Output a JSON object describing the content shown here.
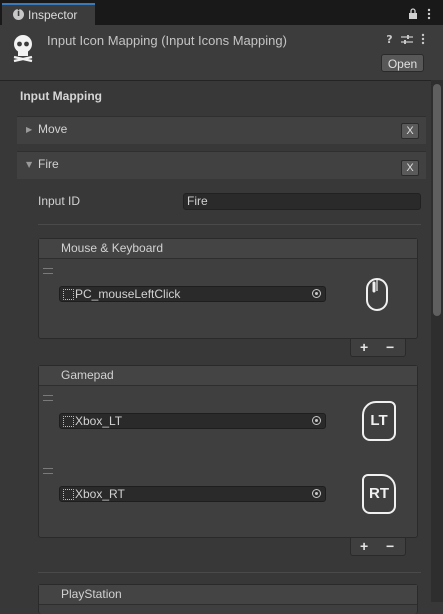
{
  "tab": {
    "label": "Inspector"
  },
  "header": {
    "title": "Input Icon Mapping (Input Icons Mapping)",
    "open_label": "Open"
  },
  "section_title": "Input Mapping",
  "entries": [
    {
      "label": "Move",
      "remove_label": "X"
    },
    {
      "label": "Fire",
      "remove_label": "X"
    }
  ],
  "fire": {
    "input_id_label": "Input ID",
    "input_id_value": "Fire",
    "groups": [
      {
        "title": "Mouse & Keyboard",
        "items": [
          {
            "value": "PC_mouseLeftClick",
            "icon": "mouse-left-click-icon"
          }
        ]
      },
      {
        "title": "Gamepad",
        "items": [
          {
            "value": "Xbox_LT",
            "icon_text": "LT"
          },
          {
            "value": "Xbox_RT",
            "icon_text": "RT"
          }
        ]
      },
      {
        "title": "PlayStation",
        "items": []
      }
    ],
    "add_label": "+",
    "remove_label": "−"
  },
  "colors": {
    "accent": "#3a79bb",
    "background": "#383838",
    "field": "#2a2a2a"
  }
}
